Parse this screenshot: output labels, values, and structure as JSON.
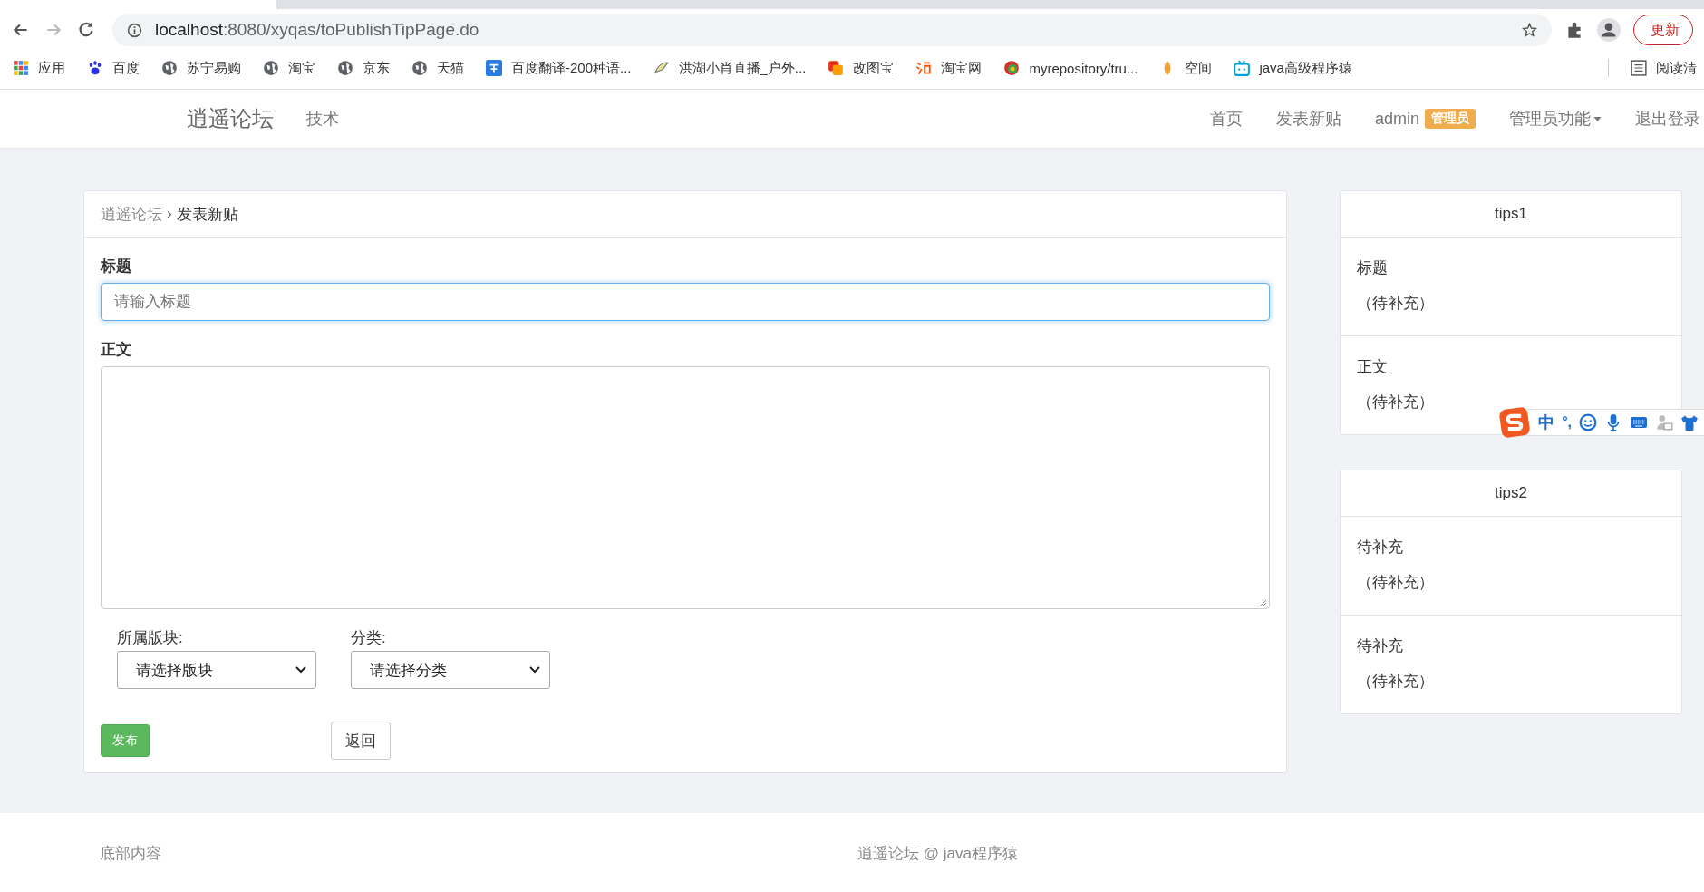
{
  "browser": {
    "host": "localhost",
    "path": ":8080/xyqas/toPublishTipPage.do",
    "update_button": "更新",
    "reading_list": "阅读清",
    "bookmarks": [
      {
        "label": "应用"
      },
      {
        "label": "百度"
      },
      {
        "label": "苏宁易购"
      },
      {
        "label": "淘宝"
      },
      {
        "label": "京东"
      },
      {
        "label": "天猫"
      },
      {
        "label": "百度翻译-200种语..."
      },
      {
        "label": "洪湖小肖直播_户外..."
      },
      {
        "label": "改图宝"
      },
      {
        "label": "淘宝网"
      },
      {
        "label": "myrepository/tru..."
      },
      {
        "label": "空间"
      },
      {
        "label": "java高级程序猿"
      }
    ]
  },
  "navbar": {
    "brand": "逍遥论坛",
    "left_links": [
      "技术"
    ],
    "right_links": [
      {
        "label": "首页",
        "kind": "link"
      },
      {
        "label": "发表新贴",
        "kind": "link"
      },
      {
        "label": "admin",
        "kind": "user",
        "badge": "管理员"
      },
      {
        "label": "管理员功能",
        "kind": "dropdown"
      },
      {
        "label": "退出登录",
        "kind": "link"
      }
    ]
  },
  "breadcrumb": {
    "items": [
      "逍遥论坛",
      "发表新贴"
    ],
    "separator": "›"
  },
  "form": {
    "title_label": "标题",
    "title_placeholder": "请输入标题",
    "title_focused": true,
    "body_label": "正文",
    "selects": [
      {
        "label": "所属版块:",
        "value": "请选择版块"
      },
      {
        "label": "分类:",
        "value": "请选择分类"
      }
    ],
    "buttons": [
      {
        "label": "发布",
        "kind": "primary"
      },
      {
        "label": "返回",
        "kind": "default"
      }
    ]
  },
  "sidebar": [
    {
      "title": "tips1",
      "items": [
        {
          "heading": "标题",
          "text": "（待补充）"
        },
        {
          "heading": "正文",
          "text": "（待补充）"
        }
      ]
    },
    {
      "title": "tips2",
      "items": [
        {
          "heading": "待补充",
          "text": "（待补充）"
        },
        {
          "heading": "待补充",
          "text": "（待补充）"
        }
      ]
    }
  ],
  "ime_toolbar": {
    "mode": "中",
    "punctuation": "°,"
  },
  "footer": {
    "left": "底部内容",
    "right": "逍遥论坛 @ java程序猿"
  }
}
